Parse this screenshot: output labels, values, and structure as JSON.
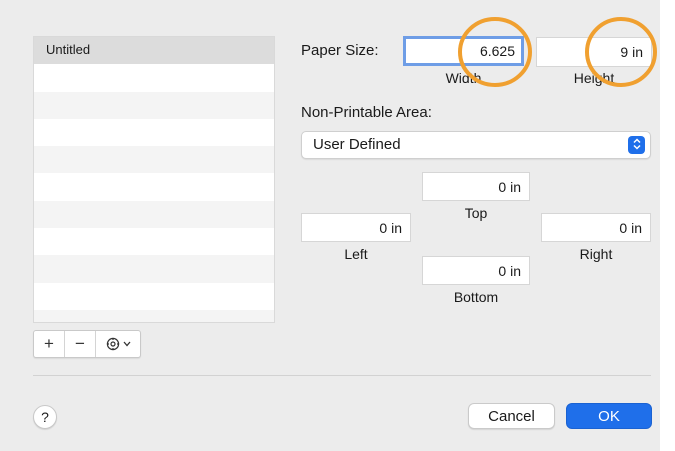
{
  "profiles": {
    "items": [
      {
        "label": "Untitled",
        "selected": true
      },
      {
        "label": ""
      },
      {
        "label": ""
      },
      {
        "label": ""
      },
      {
        "label": ""
      },
      {
        "label": ""
      },
      {
        "label": ""
      },
      {
        "label": ""
      },
      {
        "label": ""
      },
      {
        "label": ""
      },
      {
        "label": ""
      }
    ],
    "buttons": {
      "add": "+",
      "remove": "−",
      "action_icon": "gear-icon",
      "chevron_icon": "chevron-down-icon"
    }
  },
  "paper_size": {
    "label": "Paper Size:",
    "width_value": "6.625",
    "width_caption": "Width",
    "height_value": "9 in",
    "height_caption": "Height"
  },
  "non_printable": {
    "label": "Non-Printable Area:",
    "selected": "User Defined",
    "top": {
      "value": "0 in",
      "caption": "Top"
    },
    "left": {
      "value": "0 in",
      "caption": "Left"
    },
    "right": {
      "value": "0 in",
      "caption": "Right"
    },
    "bottom": {
      "value": "0 in",
      "caption": "Bottom"
    }
  },
  "footer": {
    "help": "?",
    "cancel": "Cancel",
    "ok": "OK"
  },
  "colors": {
    "accent": "#1f6fea",
    "focus_ring": "#6e9de6",
    "annotation": "#f0a030"
  }
}
